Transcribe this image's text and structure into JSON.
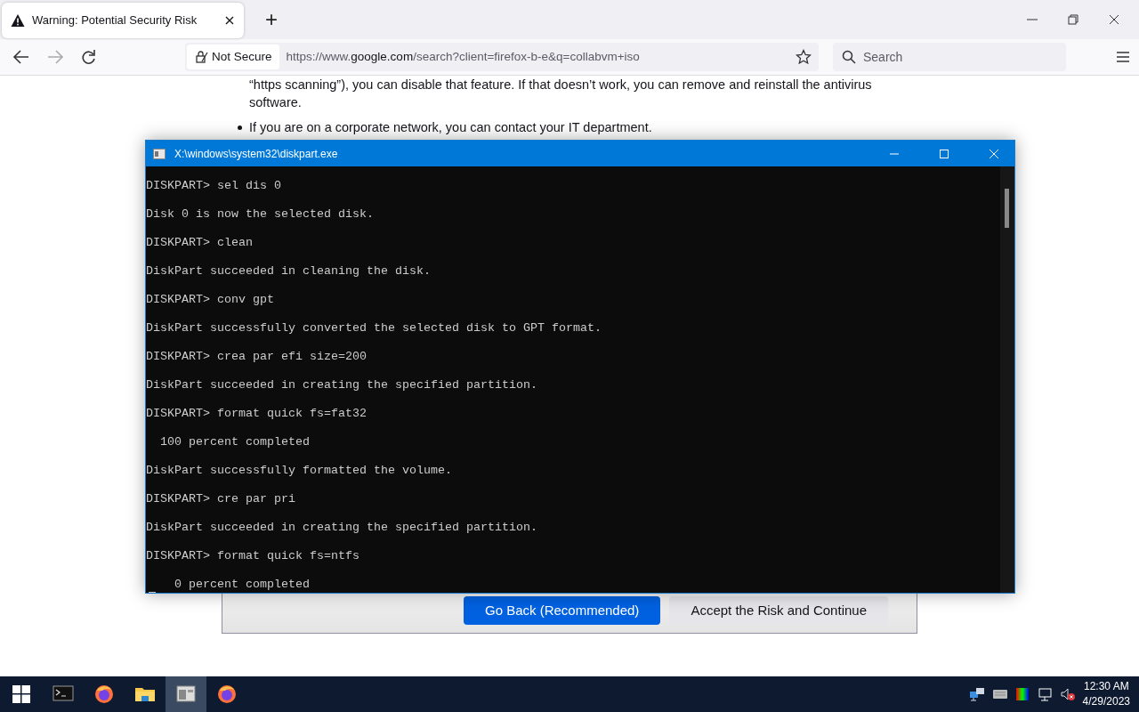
{
  "browser": {
    "tab": {
      "title": "Warning: Potential Security Risk",
      "selected": true
    },
    "new_tab": "+",
    "toolbar": {
      "security": "Not Secure",
      "url_prefix": "https://www.",
      "url_host": "google.com",
      "url_rest": "/search?client=firefox-b-e&q=collabvm+iso",
      "search_placeholder": "Search"
    }
  },
  "page": {
    "paragraphs": [
      {
        "kind": "continuation",
        "text": "“https scanning”), you can disable that feature. If that doesn’t work, you can remove and reinstall the antivirus software."
      },
      {
        "kind": "bullet",
        "text": "If you are on a corporate network, you can contact your IT department."
      }
    ],
    "buttons": [
      {
        "label": "Go Back (Recommended)",
        "primary": true
      },
      {
        "label": "Accept the Risk and Continue",
        "primary": false
      }
    ]
  },
  "console": {
    "title": "X:\\windows\\system32\\diskpart.exe",
    "lines": [
      "DISKPART> sel dis 0",
      "Disk 0 is now the selected disk.",
      "DISKPART> clean",
      "DiskPart succeeded in cleaning the disk.",
      "DISKPART> conv gpt",
      "DiskPart successfully converted the selected disk to GPT format.",
      "DISKPART> crea par efi size=200",
      "DiskPart succeeded in creating the specified partition.",
      "DISKPART> format quick fs=fat32",
      "  100 percent completed",
      "DiskPart successfully formatted the volume.",
      "DISKPART> cre par pri",
      "DiskPart succeeded in creating the specified partition.",
      "DISKPART> format quick fs=ntfs",
      "    0 percent completed"
    ]
  },
  "taskbar": {
    "apps": [
      {
        "kind": "terminal",
        "selected": false
      },
      {
        "kind": "firefox",
        "selected": false
      },
      {
        "kind": "folder",
        "selected": false
      },
      {
        "kind": "window",
        "selected": true
      },
      {
        "kind": "firefox",
        "selected": false
      }
    ],
    "time": "12:30 AM",
    "date": "4/29/2023"
  }
}
